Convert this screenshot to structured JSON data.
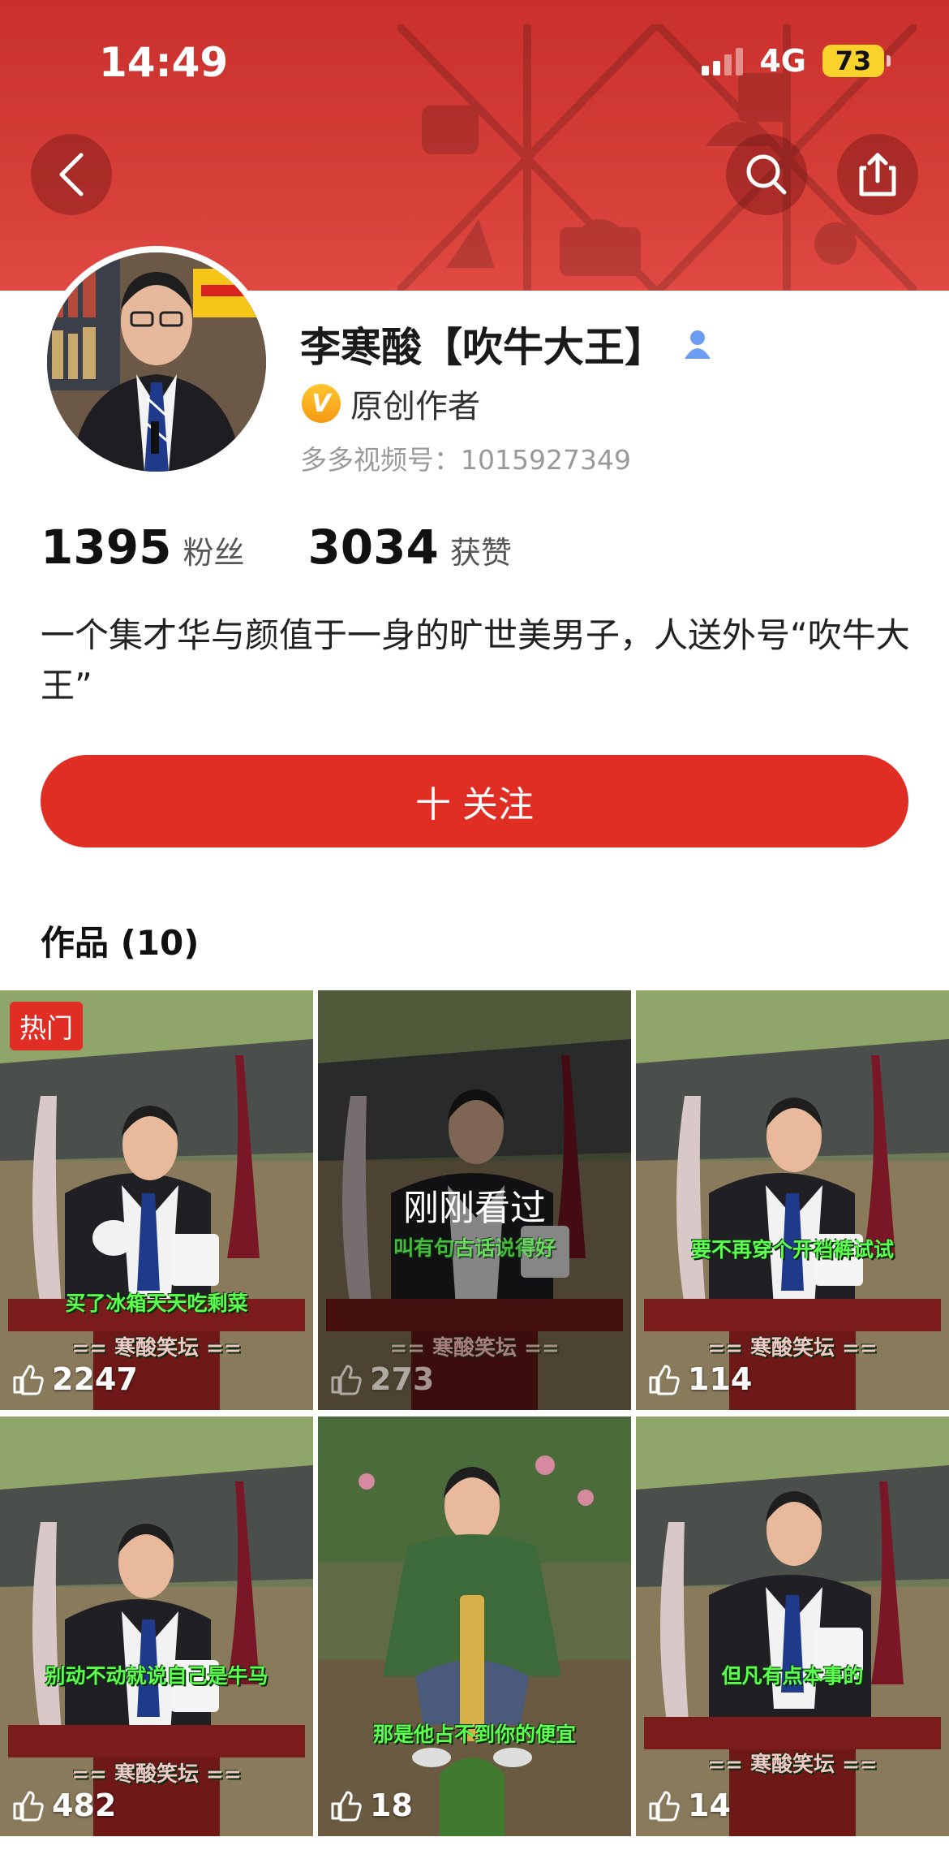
{
  "status_bar": {
    "time": "14:49",
    "network": "4G",
    "battery": "73"
  },
  "colors": {
    "brand_red": "#e02e24",
    "header_red": "#d03a34",
    "verified_gold": "#f5a623",
    "caption_green": "#5cff4f"
  },
  "profile": {
    "name": "李寒酸【吹牛大王】",
    "verified_label": "原创作者",
    "id_line": "多多视频号：1015927349",
    "followers_count": "1395",
    "followers_label": "粉丝",
    "likes_count": "3034",
    "likes_label": "获赞",
    "bio": "一个集才华与颜值于一身的旷世美男子，人送外号“吹牛大王”",
    "follow_button": "十 关注"
  },
  "works": {
    "title": "作品 (10)",
    "items": [
      {
        "badge": "热门",
        "caption": "买了冰箱天天吃剩菜",
        "likes": "2247",
        "stage_sign": "== 寒酸笑坛 =="
      },
      {
        "overlay": "刚刚看过",
        "caption": "叫有句古话说得好",
        "likes": "273",
        "stage_sign": "== 寒酸笑坛 =="
      },
      {
        "caption": "要不再穿个开裆裤试试",
        "likes": "114",
        "stage_sign": "== 寒酸笑坛 =="
      },
      {
        "caption": "别动不动就说自己是牛马",
        "likes": "482",
        "stage_sign": "== 寒酸笑坛 =="
      },
      {
        "caption": "那是他占不到你的便宜",
        "likes": "18"
      },
      {
        "caption": "但凡有点本事的",
        "likes": "14",
        "stage_sign": "== 寒酸笑坛 =="
      }
    ]
  },
  "icons": [
    "back-chevron-icon",
    "search-icon",
    "share-icon",
    "user-profile-icon",
    "verified-v-icon",
    "thumbs-up-icon"
  ]
}
